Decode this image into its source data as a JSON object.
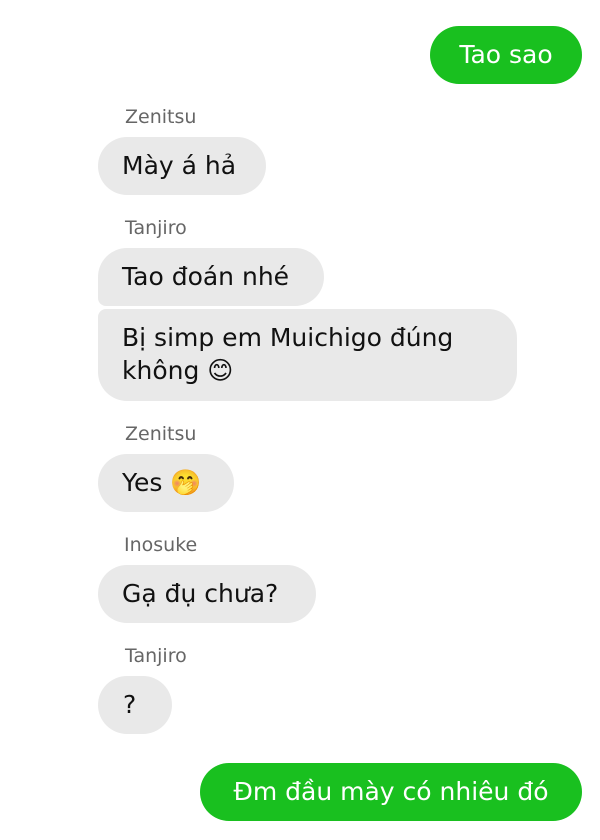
{
  "messages": {
    "m1": {
      "text": "Tao sao"
    },
    "s2": {
      "name": "Zenitsu"
    },
    "m2": {
      "text": "Mày á hả"
    },
    "s3": {
      "name": "Tanjiro"
    },
    "m3": {
      "text": "Tao đoán nhé"
    },
    "m4": {
      "line1": "Bị simp em Muichigo đúng",
      "line2": "không 😊"
    },
    "s5": {
      "name": "Zenitsu"
    },
    "m5": {
      "text": "Yes 🤭"
    },
    "s6": {
      "name": "Inosuke"
    },
    "m6": {
      "text": "Gạ đụ chưa?"
    },
    "s7": {
      "name": "Tanjiro"
    },
    "m7": {
      "text": "?"
    },
    "m8": {
      "text": "Đm đầu mày có nhiêu đó"
    }
  },
  "colors": {
    "outgoing_bubble": "#19c01f",
    "incoming_bubble": "#e9e9e9",
    "sender_name": "#666666"
  }
}
